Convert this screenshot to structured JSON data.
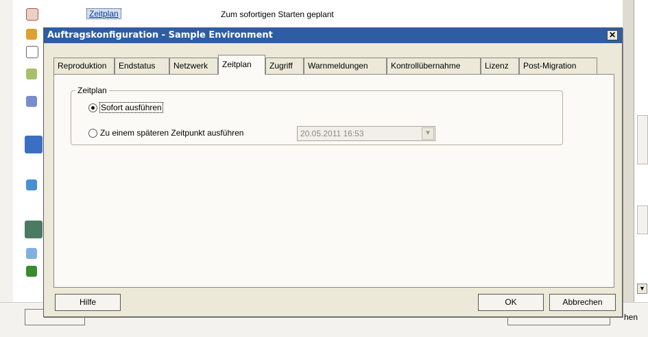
{
  "background": {
    "selected_item": "Zeitplan",
    "row_text": "Zum sofortigen Starten geplant",
    "bottom_right_fragment": "hen"
  },
  "dialog": {
    "title": "Auftragskonfiguration - Sample Environment",
    "close_symbol": "✕",
    "tabs": [
      {
        "label": "Reproduktion"
      },
      {
        "label": "Endstatus"
      },
      {
        "label": "Netzwerk"
      },
      {
        "label": "Zeitplan"
      },
      {
        "label": "Zugriff"
      },
      {
        "label": "Warnmeldungen"
      },
      {
        "label": "Kontrollübernahme"
      },
      {
        "label": "Lizenz"
      },
      {
        "label": "Post-Migration"
      }
    ],
    "active_tab": "Zeitplan",
    "group": {
      "legend": "Zeitplan",
      "option_now": "Sofort ausführen",
      "option_later": "Zu einem späteren Zeitpunkt ausführen",
      "selected": "option_now",
      "datetime_value": "20.05.2011 16:53",
      "datetime_enabled": false
    },
    "buttons": {
      "help": "Hilfe",
      "ok": "OK",
      "cancel": "Abbrechen"
    }
  },
  "colors": {
    "titlebar": "#2d5ea3",
    "dialog_bg": "#ece9d8",
    "panel_bg": "#fbfaf6"
  }
}
